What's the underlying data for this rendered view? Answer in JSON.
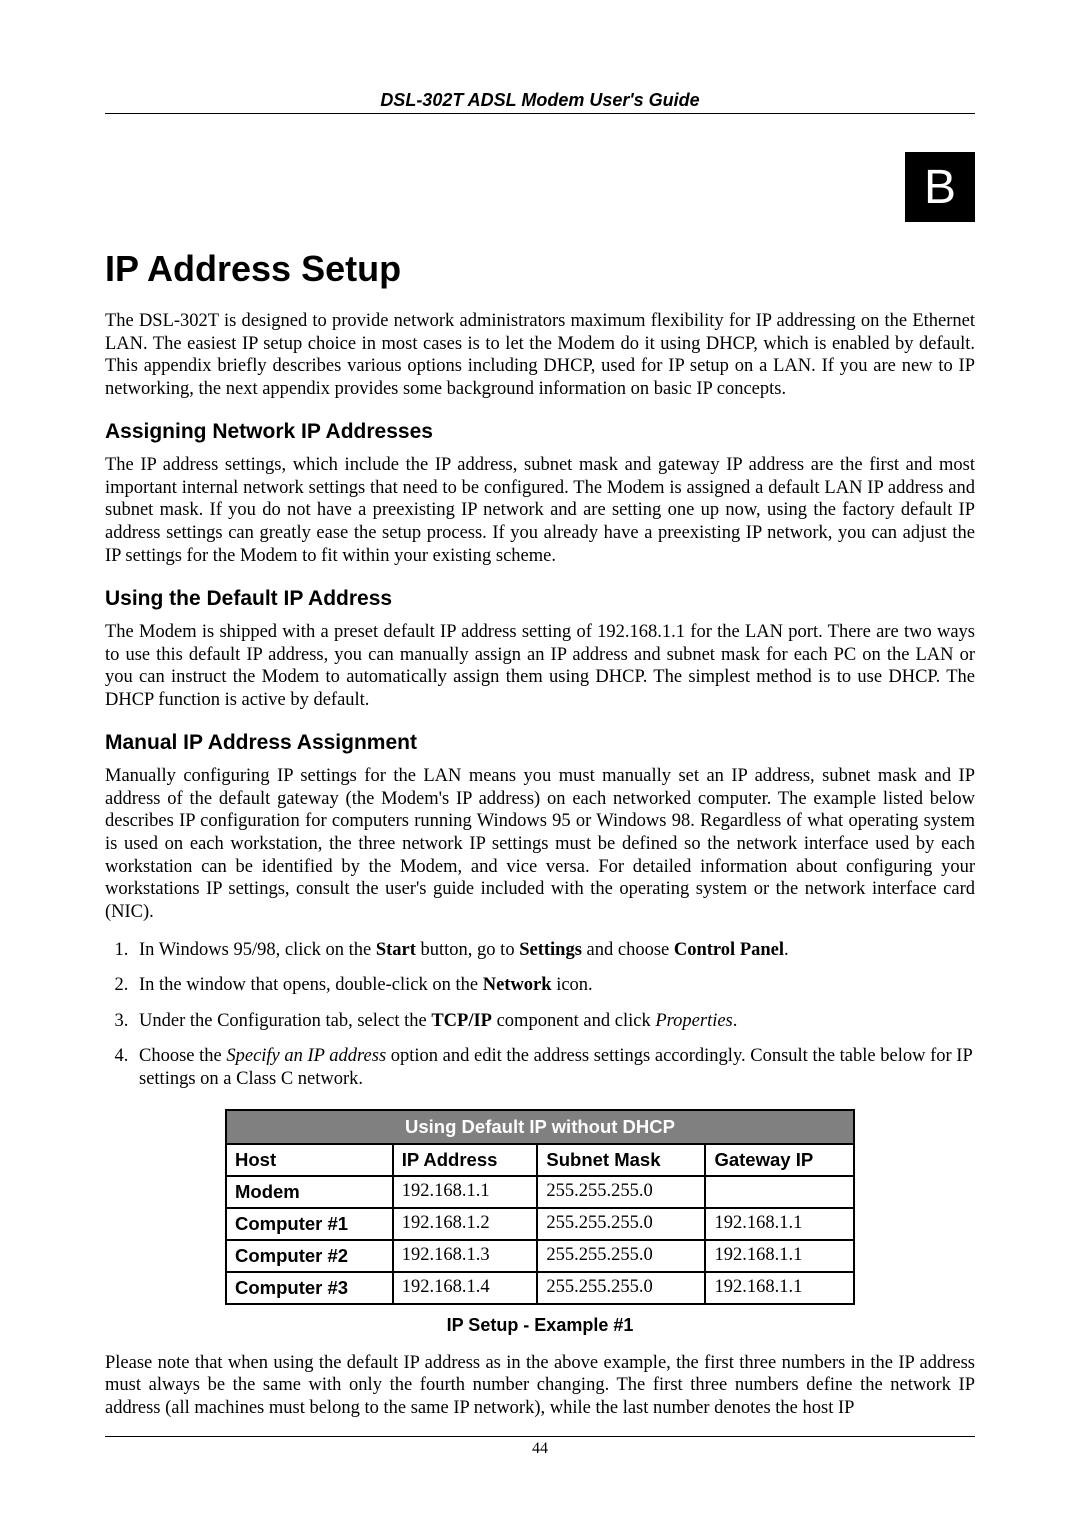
{
  "header": {
    "doc_title": "DSL-302T ADSL Modem User's Guide"
  },
  "appendix_letter": "B",
  "title": "IP Address Setup",
  "intro": "The DSL-302T is designed to provide network administrators maximum flexibility for IP addressing on the Ethernet LAN. The easiest IP setup choice in most cases is to let the Modem do it using DHCP, which is enabled by default. This appendix briefly describes various options including DHCP, used for IP setup on a LAN. If you are new to IP networking, the next appendix provides some background information on basic IP concepts.",
  "sec_assign": {
    "heading": "Assigning Network IP Addresses",
    "body": "The IP address settings, which include the IP address, subnet mask and gateway IP address are the first and most important internal network settings that need to be configured. The Modem is assigned a default LAN IP address and subnet mask.  If you do not have a preexisting IP network and are setting one up now, using the factory default IP address settings can greatly ease the setup process. If you already have a preexisting IP network, you can adjust the IP settings for the Modem to fit within your existing scheme."
  },
  "sec_default": {
    "heading": "Using the Default IP Address",
    "body": "The Modem is shipped with a preset default IP address setting of 192.168.1.1 for the LAN port.  There are two ways to use this default IP address, you can manually assign an IP address and subnet mask for each PC on the LAN or you can instruct the Modem to automatically assign them using DHCP. The simplest method is to use DHCP. The DHCP function is active by default."
  },
  "sec_manual": {
    "heading": "Manual IP Address Assignment",
    "body": "Manually configuring IP settings for the LAN means you must manually set an IP address, subnet mask and IP address of the default gateway (the Modem's IP address) on each networked computer. The example listed below describes IP configuration for computers running Windows 95 or Windows 98. Regardless of what operating system is used on each workstation, the three network IP settings must be defined so the network interface used by each workstation can be identified by the Modem, and vice versa. For detailed information about configuring your workstations IP settings, consult the user's guide included with the operating system or the network interface card (NIC)."
  },
  "steps": {
    "s1_a": "In Windows 95/98, click on the ",
    "s1_b": "Start",
    "s1_c": " button, go to ",
    "s1_d": "Settings",
    "s1_e": " and choose ",
    "s1_f": "Control Panel",
    "s1_g": ".",
    "s2_a": "In the window that opens, double-click on the ",
    "s2_b": "Network",
    "s2_c": " icon.",
    "s3_a": "Under the Configuration tab, select the ",
    "s3_b": "TCP/IP",
    "s3_c": " component and click ",
    "s3_d": "Properties",
    "s3_e": ".",
    "s4_a": "Choose the ",
    "s4_b": "Specify an IP address",
    "s4_c": " option and edit the address settings accordingly. Consult the table below for IP settings on a Class C network."
  },
  "table": {
    "title": "Using Default IP without DHCP",
    "cols": [
      "Host",
      "IP Address",
      "Subnet Mask",
      "Gateway IP"
    ],
    "rows": [
      {
        "host": "Modem",
        "ip": "192.168.1.1",
        "mask": "255.255.255.0",
        "gw": ""
      },
      {
        "host": "Computer #1",
        "ip": "192.168.1.2",
        "mask": "255.255.255.0",
        "gw": "192.168.1.1"
      },
      {
        "host": "Computer #2",
        "ip": "192.168.1.3",
        "mask": "255.255.255.0",
        "gw": "192.168.1.1"
      },
      {
        "host": "Computer #3",
        "ip": "192.168.1.4",
        "mask": "255.255.255.0",
        "gw": "192.168.1.1"
      }
    ],
    "caption": "IP Setup - Example #1"
  },
  "closing": "Please note that when using the default IP address as in the above example, the first three numbers in the IP address must always be the same with only the fourth number changing. The first three numbers define the network IP address (all machines must belong to the same IP network), while the last number denotes the host IP",
  "page_number": "44"
}
